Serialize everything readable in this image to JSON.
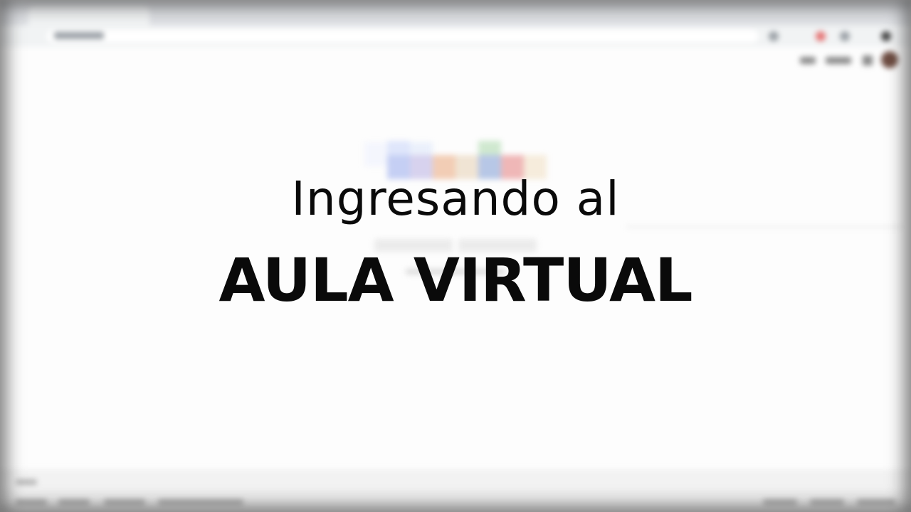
{
  "overlay": {
    "line1": "Ingresando al",
    "line2": "AULA VIRTUAL"
  },
  "colors": {
    "title": "#0a0a0a",
    "background": "#ffffff",
    "logo_colors": [
      "#dfe6fb",
      "#c5cff4",
      "#d7d2ee",
      "#f2cdb5",
      "#cfe8cf",
      "#b7c7e6",
      "#efb7b7",
      "#f6ecdc"
    ]
  },
  "icons": [
    "google-apps-icon",
    "account-avatar-icon",
    "browser-menu-icon"
  ]
}
